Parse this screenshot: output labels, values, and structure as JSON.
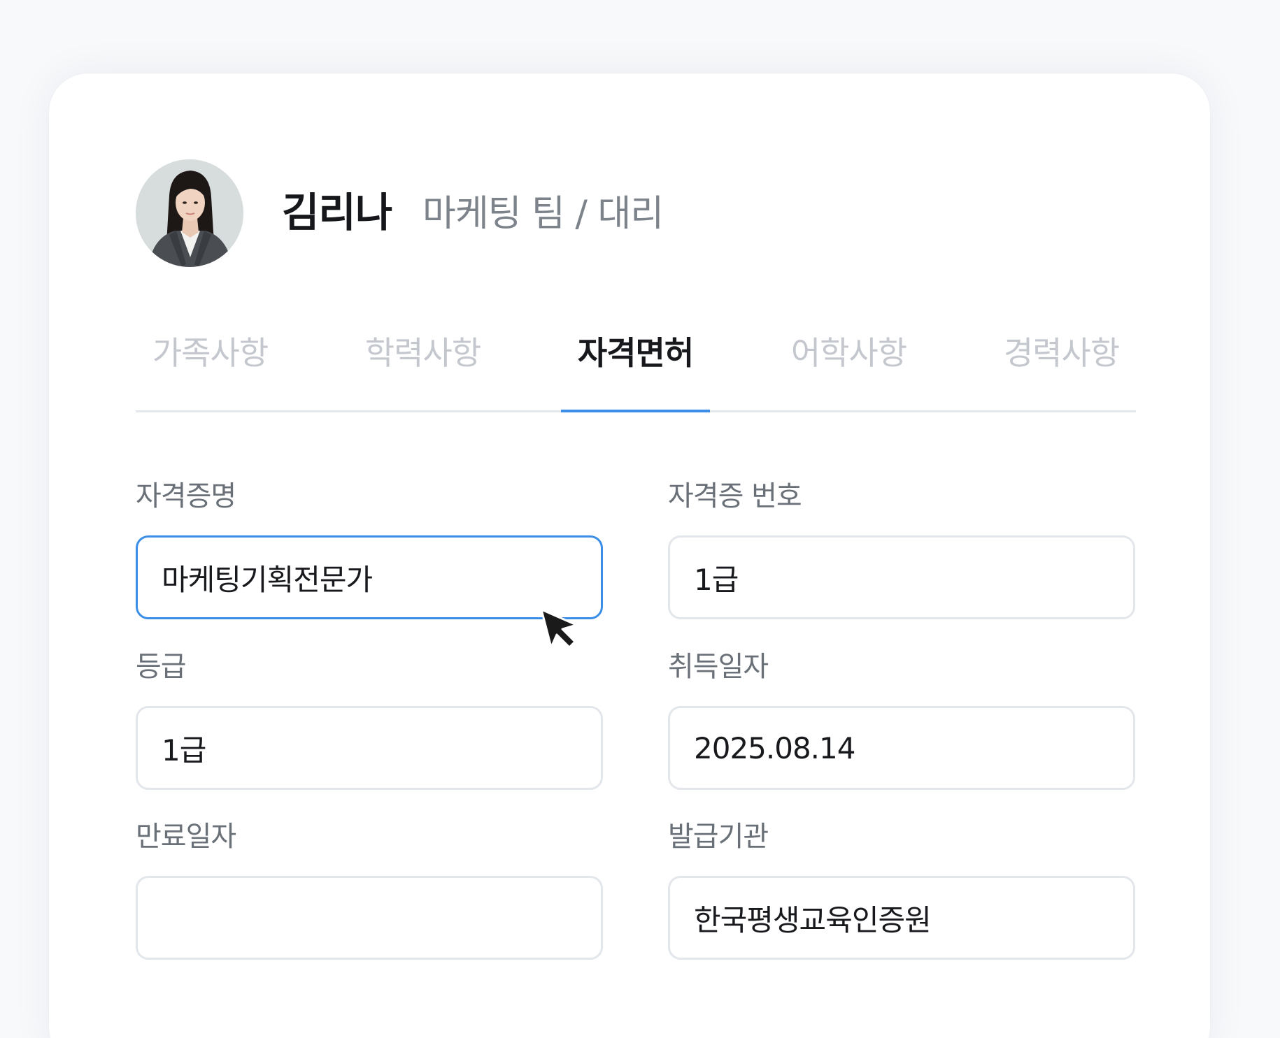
{
  "profile": {
    "name": "김리나",
    "department": "마케팅 팀 / 대리"
  },
  "tabs": [
    {
      "label": "가족사항",
      "active": false
    },
    {
      "label": "학력사항",
      "active": false
    },
    {
      "label": "자격면허",
      "active": true
    },
    {
      "label": "어학사항",
      "active": false
    },
    {
      "label": "경력사항",
      "active": false
    }
  ],
  "form": {
    "certificate_name": {
      "label": "자격증명",
      "value": "마케팅기획전문가"
    },
    "certificate_number": {
      "label": "자격증 번호",
      "value": "1급"
    },
    "grade": {
      "label": "등급",
      "value": "1급"
    },
    "acquired_date": {
      "label": "취득일자",
      "value": "2025.08.14"
    },
    "expiry_date": {
      "label": "만료일자",
      "value": ""
    },
    "issuer": {
      "label": "발급기관",
      "value": "한국평생교육인증원"
    }
  },
  "colors": {
    "accent": "#3b8ee8",
    "inactive_tab": "#c4c8ce",
    "label": "#6a7078",
    "border": "#e3e6eb"
  }
}
